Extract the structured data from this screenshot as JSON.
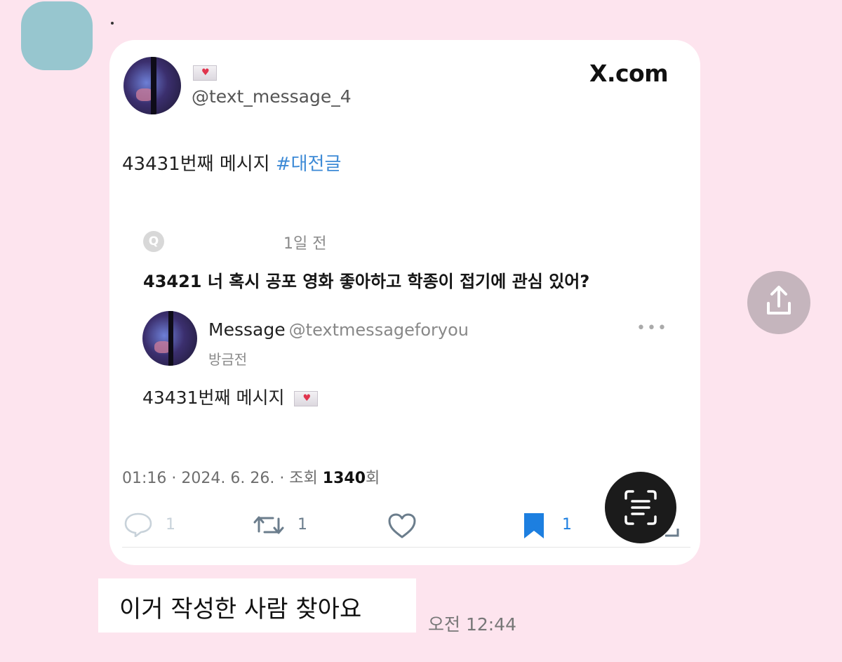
{
  "chat": {
    "sender_marker": ".",
    "bubble_text": "이거 작성한 사람 찾아요",
    "time": "오전 12:44"
  },
  "post": {
    "handle": "@text_message_4",
    "brand": "X.com",
    "text": "43431번째 메시지",
    "hashtag": "#대전글",
    "quote": {
      "badge": "Q",
      "time": "1일 전",
      "text": "43421 너 혹시 공포 영화 좋아하고 학종이 접기에 관심 있어?"
    },
    "reply": {
      "name": "Message",
      "handle": "@textmessageforyou",
      "time": "방금전",
      "text": "43431번째 메시지",
      "more": "•••"
    },
    "meta": {
      "prefix": "01:16 · 2024. 6. 26. · 조회 ",
      "views": "1340",
      "suffix": "회"
    },
    "actions": {
      "replies": "1",
      "reposts": "1",
      "bookmarks": "1"
    },
    "colors": {
      "hashtag": "#3d8ad6",
      "bookmark": "#1d7fe0",
      "chat_background": "#fde4ee"
    }
  },
  "icons": {
    "envelope": "envelope-heart-icon",
    "share": "share-icon",
    "scan": "text-scan-icon"
  }
}
